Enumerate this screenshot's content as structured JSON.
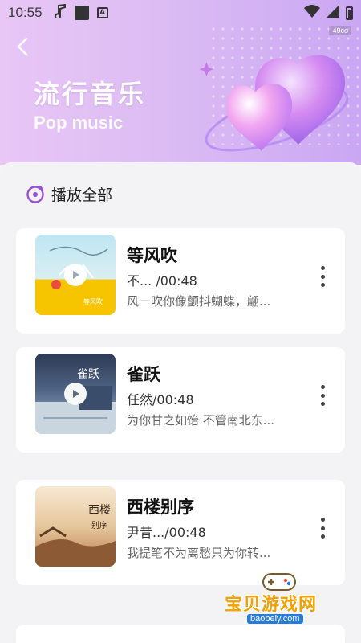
{
  "status_bar": {
    "time": "10:55",
    "corner_label": "49co"
  },
  "header": {
    "title": "流行音乐",
    "subtitle": "Pop music",
    "back_icon": "chevron-left-icon"
  },
  "play_all": {
    "label": "播放全部",
    "icon": "music-disc-icon"
  },
  "songs": [
    {
      "title": "等风吹",
      "meta": "不... /00:48",
      "lyric": "风一吹你像颤抖蝴蝶，翩..."
    },
    {
      "title": "雀跃",
      "meta": "任然/00:48",
      "lyric": "为你甘之如饴 不管南北东..."
    },
    {
      "title": "西楼别序",
      "meta": "尹昔.../00:48",
      "lyric": "我提笔不为离愁只为你转..."
    }
  ],
  "watermark": {
    "name": "宝贝游戏网",
    "url": "baobeiy.com"
  },
  "colors": {
    "accent": "#9b4fd6",
    "banner_start": "#e8c6f6",
    "banner_end": "#caa7f3"
  }
}
